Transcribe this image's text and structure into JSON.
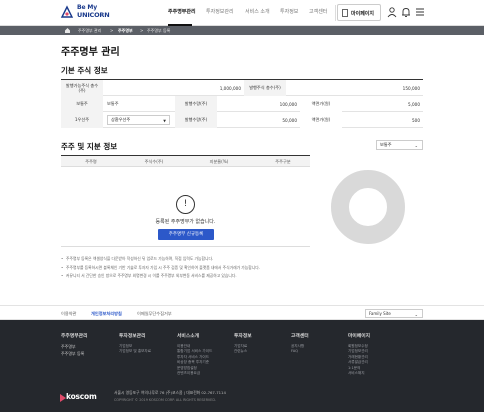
{
  "header": {
    "logo_line1": "Be My",
    "logo_line2": "UNICORN",
    "nav": [
      "주주명부관리",
      "투자정보관리",
      "서비스 소개",
      "투자정보",
      "고객센터"
    ],
    "mypage_label": "마이페이지"
  },
  "breadcrumb": [
    "주주명부 관리",
    "주주명부",
    "주주명부 등록"
  ],
  "page_title": "주주명부 관리",
  "basic_info": {
    "section_title": "기본 주식 정보",
    "rows": [
      {
        "c1_label": "발행가능주식\n총수(주)",
        "c1_value": "1,000,000",
        "c2_label": "발행주식 총수(주)",
        "c2_value": "150,000"
      },
      {
        "c1_label": "보통주",
        "c1_value": "보통주",
        "c2_label": "발행수량(주)",
        "c2_value": "100,000",
        "c3_label": "액면가(원)",
        "c3_value": "5,000"
      },
      {
        "c1_label": "1우선주",
        "c1_select": "상환우선주",
        "c2_label": "발행수량(주)",
        "c2_value": "50,000",
        "c3_label": "액면가(원)",
        "c3_value": "500"
      }
    ]
  },
  "shareholders": {
    "section_title": "주주 및 지분 정보",
    "sort_value": "보통주",
    "columns": [
      "주주명",
      "주식수(주)",
      "지분율(%)",
      "주주구분"
    ],
    "empty_message": "등록된 주주명부가 없습니다.",
    "register_button": "주주명부 신규등록"
  },
  "notes": [
    "주주명부 등록은 엑셀양식을 다운받아 작성하신 뒤 업로드 가능하며, 직접 입력도 가능합니다.",
    "주주명부를 등록하시면 블록체인 기반 기술로 투자자 가입 시 주주 검증 및 확인하여 플랫폼 내에서 주식거래가 가능합니다.",
    "커뮤니티 서 간단한 승인 방으로 주주명부 외명변경 시 이를 주주명부 외부변동 서비스를 제공하고 있습니다."
  ],
  "footer": {
    "links": [
      "이용약관",
      "개인정보처리방침",
      "이메일무단수집거부"
    ],
    "family_site": "Family Site",
    "columns": [
      {
        "title": "주주명부관리",
        "items": [
          "주주명부",
          "주주명부 등록"
        ]
      },
      {
        "title": "투자정보관리",
        "items": [
          "기업정보",
          "기업정보 및 홍보자료"
        ]
      },
      {
        "title": "서비스소개",
        "items": [
          "이용안내",
          "통합기업 서비스 가이드",
          "투자자 서비스 가이드",
          "비상장 종목 투자기준",
          "운영방침설정",
          "컨텐츠이용요금"
        ]
      },
      {
        "title": "투자정보",
        "items": [
          "기업자료",
          "관련뉴스"
        ]
      },
      {
        "title": "고객센터",
        "items": [
          "공지사항",
          "FAQ"
        ]
      },
      {
        "title": "마이페이지",
        "items": [
          "회원정보수정",
          "기업정보관리",
          "거래현황관리",
          "서류발급관리",
          "1:1문의",
          "서비스해지"
        ]
      }
    ],
    "brand": "koscom",
    "address": "서울시 영등포구 여의나루로 76 (주)코스콤   |   대표전화 02-767-7114",
    "copyright": "COPYRIGHT © 2019 KOSCOM CORP. ALL RIGHTS RESERVED."
  },
  "colors": {
    "accent": "#2c58c9",
    "breadcrumb_bg": "#5b5f66",
    "footer_bg": "#25282d",
    "donut": "#d9d9d9"
  },
  "chart_data": {
    "type": "pie",
    "categories": [],
    "values": []
  }
}
